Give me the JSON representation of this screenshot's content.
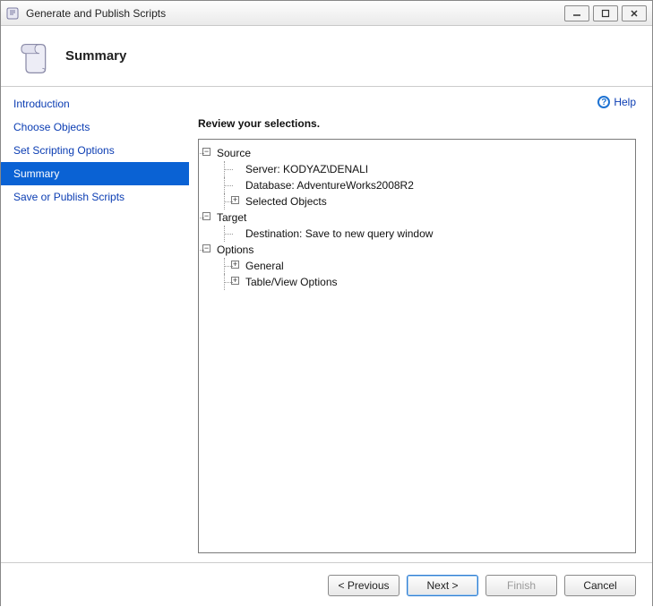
{
  "window": {
    "title": "Generate and Publish Scripts"
  },
  "header": {
    "heading": "Summary"
  },
  "sidebar": {
    "items": [
      {
        "label": "Introduction"
      },
      {
        "label": "Choose Objects"
      },
      {
        "label": "Set Scripting Options"
      },
      {
        "label": "Summary"
      },
      {
        "label": "Save or Publish Scripts"
      }
    ]
  },
  "help": {
    "label": "Help"
  },
  "content": {
    "review_label": "Review your selections."
  },
  "tree": {
    "source": {
      "label": "Source",
      "server": "Server: KODYAZ\\DENALI",
      "database": "Database: AdventureWorks2008R2",
      "selected_objects": "Selected Objects"
    },
    "target": {
      "label": "Target",
      "destination": "Destination: Save to new query window"
    },
    "options": {
      "label": "Options",
      "general": "General",
      "table_view": "Table/View Options"
    }
  },
  "footer": {
    "previous": "< Previous",
    "next": "Next >",
    "finish": "Finish",
    "cancel": "Cancel"
  }
}
